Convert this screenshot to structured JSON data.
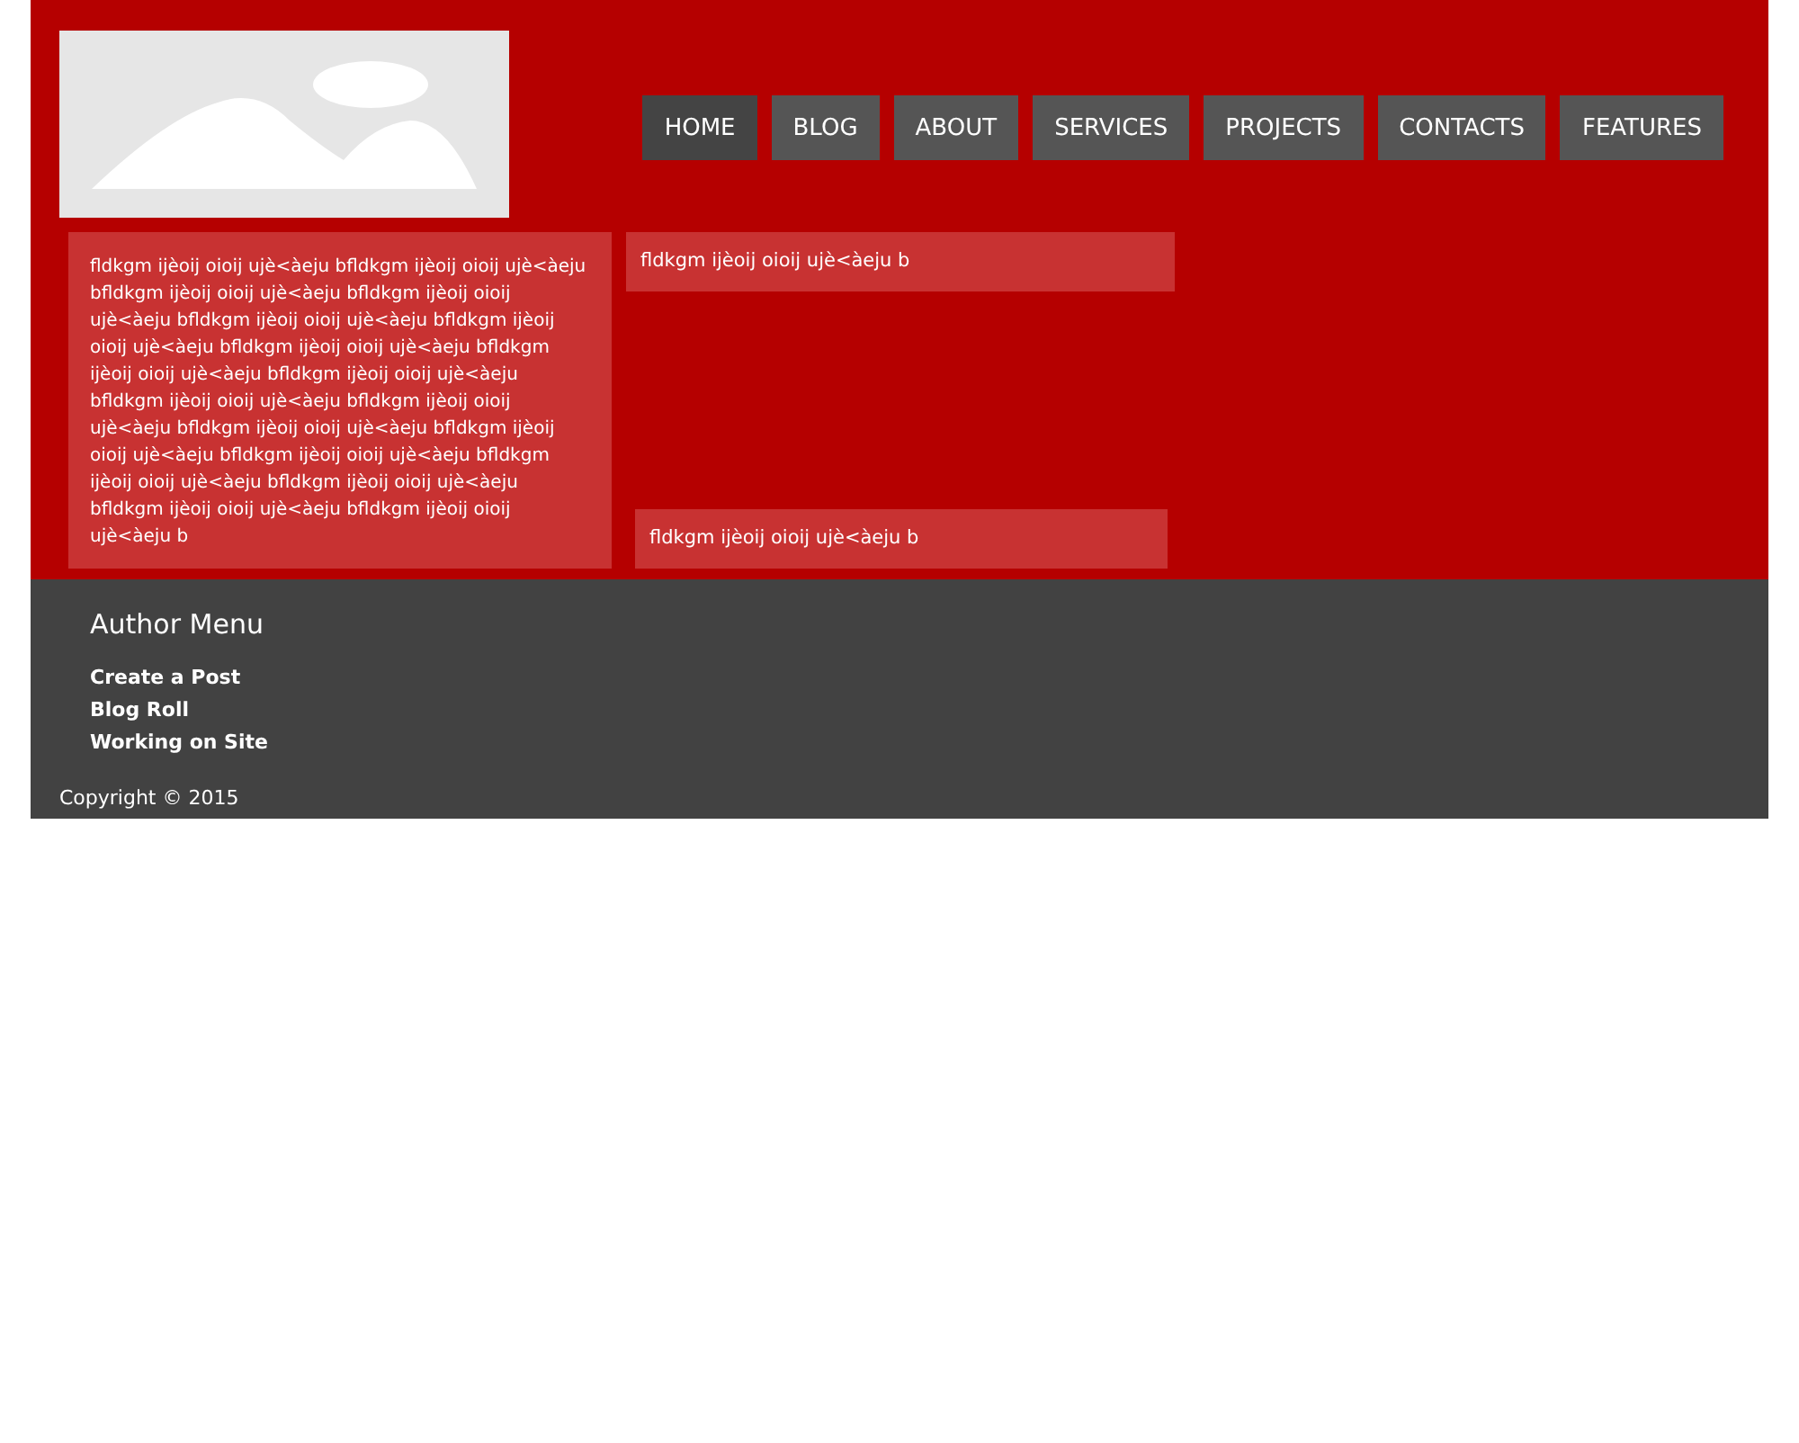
{
  "nav": [
    {
      "label": "HOME",
      "selected": true
    },
    {
      "label": "BLOG",
      "selected": false
    },
    {
      "label": "ABOUT",
      "selected": false
    },
    {
      "label": "SERVICES",
      "selected": false
    },
    {
      "label": "PROJECTS",
      "selected": false
    },
    {
      "label": "CONTACTS",
      "selected": false
    },
    {
      "label": "FEATURES",
      "selected": false
    }
  ],
  "posts": [
    "fldkgm ijèoij oioij ujè<àeju bfldkgm ijèoij oioij ujè<àeju bfldkgm ijèoij oioij ujè<àeju bfldkgm ijèoij oioij ujè<àeju bfldkgm ijèoij oioij ujè<àeju bfldkgm ijèoij oioij ujè<àeju bfldkgm ijèoij oioij ujè<àeju bfldkgm ijèoij oioij ujè<àeju bfldkgm ijèoij oioij ujè<àeju bfldkgm ijèoij oioij ujè<àeju bfldkgm ijèoij oioij ujè<àeju bfldkgm ijèoij oioij ujè<àeju bfldkgm ijèoij oioij ujè<àeju bfldkgm ijèoij oioij ujè<àeju bfldkgm ijèoij oioij ujè<àeju bfldkgm ijèoij oioij ujè<àeju bfldkgm ijèoij oioij ujè<àeju bfldkgm ijèoij oioij ujè<àeju b",
    "fldkgm ijèoij oioij ujè<àeju b",
    "fldkgm ijèoij oioij ujè<àeju b"
  ],
  "author_menu": {
    "title": "Author Menu",
    "links": [
      "Create a Post",
      "Blog Roll",
      "Working on Site"
    ]
  },
  "copyright": "Copyright © 2015"
}
